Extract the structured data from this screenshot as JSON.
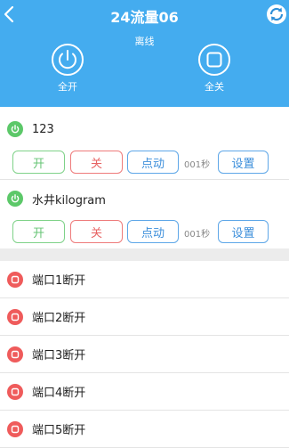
{
  "header": {
    "title": "24流量06",
    "status": "离线",
    "all_on_label": "全开",
    "all_off_label": "全关",
    "back_icon": "chevron-left-icon",
    "refresh_icon": "refresh-icon",
    "background_color": "#44acef"
  },
  "controls": [
    {
      "name": "123",
      "state": "on",
      "buttons": {
        "on": "开",
        "off": "关",
        "jog": "点动",
        "seconds": "001秒",
        "settings": "设置"
      }
    },
    {
      "name": "水井kilogram",
      "state": "on",
      "buttons": {
        "on": "开",
        "off": "关",
        "jog": "点动",
        "seconds": "001秒",
        "settings": "设置"
      }
    }
  ],
  "ports": [
    {
      "name": "端口1断开",
      "state": "off"
    },
    {
      "name": "端口2断开",
      "state": "off"
    },
    {
      "name": "端口3断开",
      "state": "off"
    },
    {
      "name": "端口4断开",
      "state": "off"
    },
    {
      "name": "端口5断开",
      "state": "off"
    }
  ],
  "colors": {
    "on_green": "#5cc869",
    "off_red": "#ef5b5b",
    "action_blue": "#3d8fdb"
  }
}
